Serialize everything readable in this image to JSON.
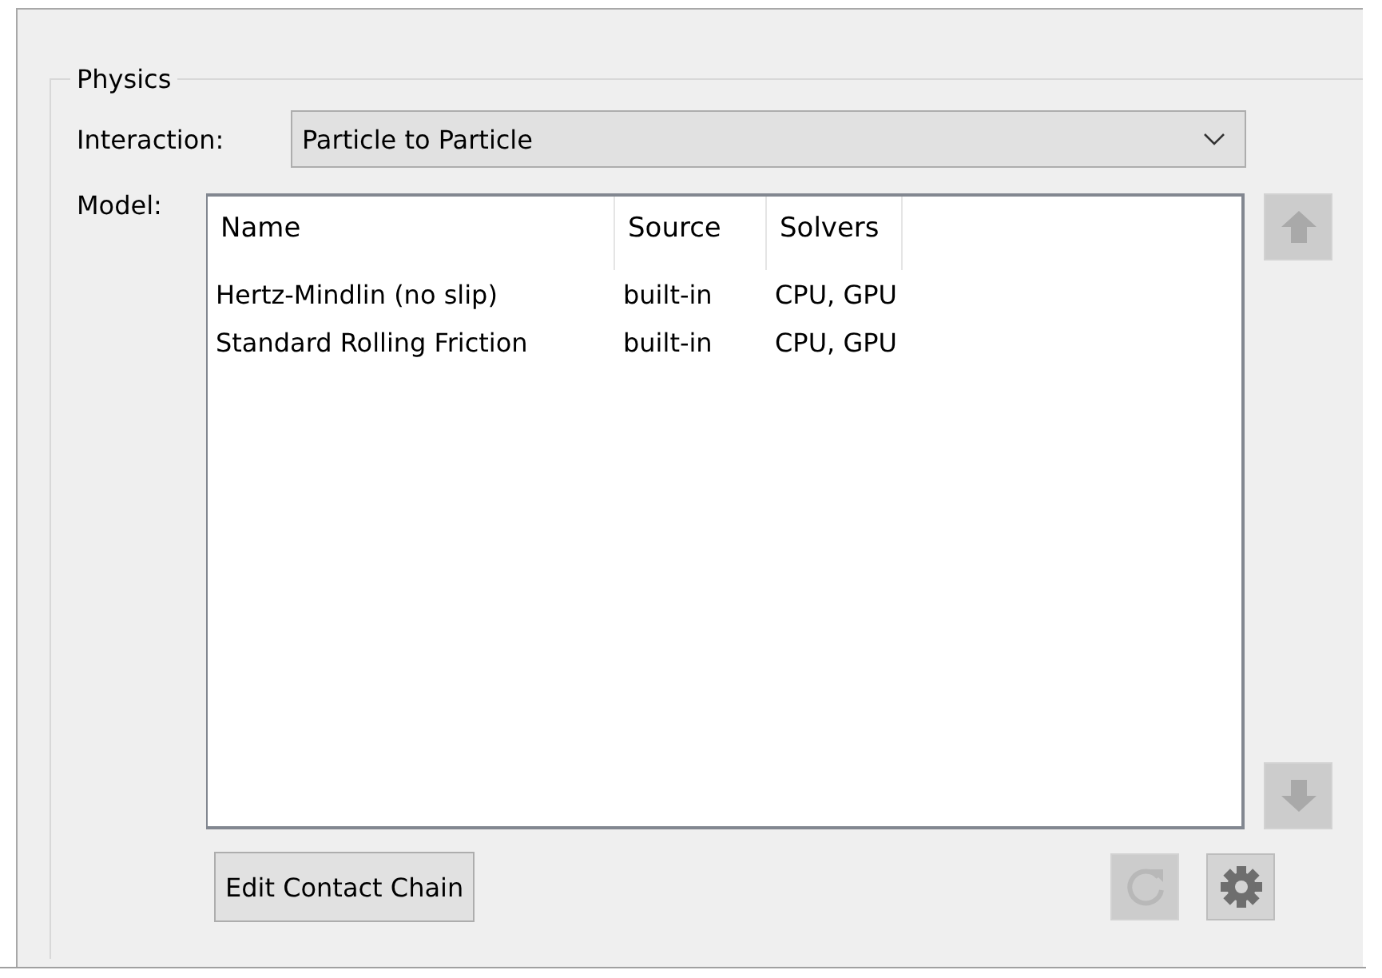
{
  "group": {
    "title": "Physics"
  },
  "interaction": {
    "label": "Interaction:",
    "value": "Particle to Particle"
  },
  "model": {
    "label": "Model:",
    "columns": [
      "Name",
      "Source",
      "Solvers"
    ],
    "rows": [
      {
        "cells": [
          "Hertz-Mindlin (no slip)",
          "built-in",
          "CPU, GPU"
        ],
        "selected": false
      },
      {
        "cells": [
          "Standard Rolling Friction",
          "built-in",
          "CPU, GPU"
        ],
        "selected": false
      }
    ],
    "move_up": {
      "disabled": true
    },
    "move_down": {
      "disabled": true
    }
  },
  "buttons": [
    {
      "kind": "text",
      "label": "Edit Contact Chain",
      "disabled": false
    },
    {
      "kind": "refresh",
      "disabled": true
    },
    {
      "kind": "settings",
      "disabled": false
    }
  ]
}
